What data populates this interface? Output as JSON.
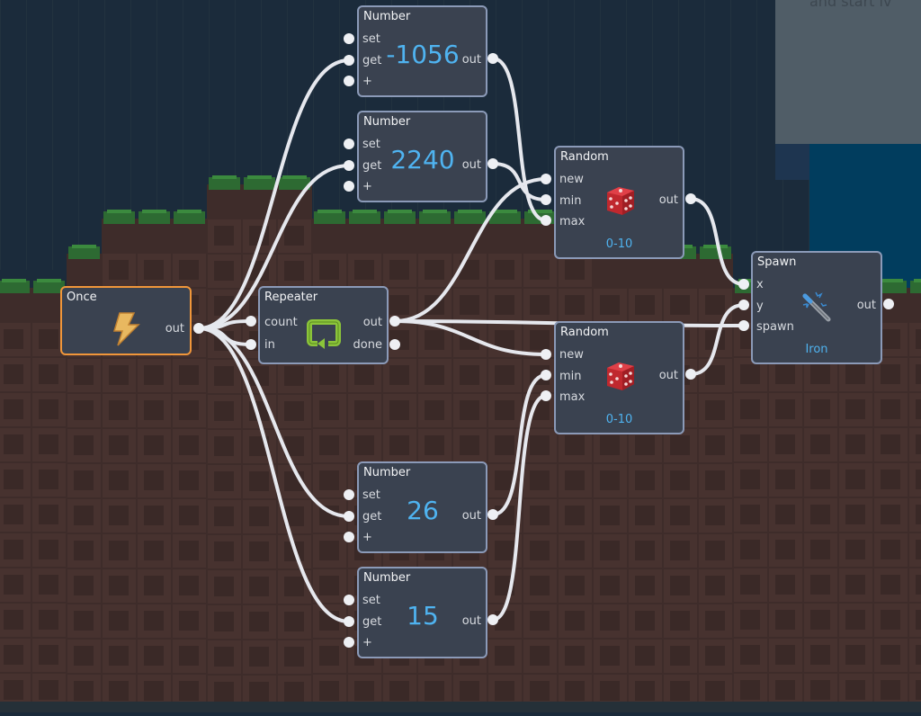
{
  "background": {
    "sky_color": "#1b2b3b",
    "dirt_color": "#3e2c2a",
    "grass_color": "#2d6a32",
    "water_color": "#013d5e",
    "overlay_color": "#505d67",
    "overlay_text": "and start lv"
  },
  "nodes": {
    "once": {
      "title": "Once",
      "icon": "lightning-bolt-icon",
      "outputs": [
        "out"
      ]
    },
    "repeater": {
      "title": "Repeater",
      "icon": "loop-arrow-icon",
      "inputs": [
        "count",
        "in"
      ],
      "outputs": [
        "out",
        "done"
      ]
    },
    "number1": {
      "title": "Number",
      "inputs": [
        "set",
        "get",
        "+"
      ],
      "value": "-1056",
      "outputs": [
        "out"
      ]
    },
    "number2": {
      "title": "Number",
      "inputs": [
        "set",
        "get",
        "+"
      ],
      "value": "2240",
      "outputs": [
        "out"
      ]
    },
    "number3": {
      "title": "Number",
      "inputs": [
        "set",
        "get",
        "+"
      ],
      "value": "26",
      "outputs": [
        "out"
      ]
    },
    "number4": {
      "title": "Number",
      "inputs": [
        "set",
        "get",
        "+"
      ],
      "value": "15",
      "outputs": [
        "out"
      ]
    },
    "random1": {
      "title": "Random",
      "icon": "dice-icon",
      "inputs": [
        "new",
        "min",
        "max"
      ],
      "outputs": [
        "out"
      ],
      "range": "0-10"
    },
    "random2": {
      "title": "Random",
      "icon": "dice-icon",
      "inputs": [
        "new",
        "min",
        "max"
      ],
      "outputs": [
        "out"
      ],
      "range": "0-10"
    },
    "spawn": {
      "title": "Spawn",
      "icon": "sword-icon",
      "inputs": [
        "x",
        "y",
        "spawn"
      ],
      "outputs": [
        "out"
      ],
      "item": "Iron"
    }
  },
  "connections": [
    [
      "once.out",
      "number1.get"
    ],
    [
      "once.out",
      "number2.get"
    ],
    [
      "once.out",
      "repeater.count"
    ],
    [
      "once.out",
      "repeater.in"
    ],
    [
      "once.out",
      "number3.get"
    ],
    [
      "once.out",
      "number4.get"
    ],
    [
      "number1.out",
      "random1.max"
    ],
    [
      "number2.out",
      "random1.min"
    ],
    [
      "number3.out",
      "random2.min"
    ],
    [
      "number4.out",
      "random2.max"
    ],
    [
      "repeater.out",
      "random1.new"
    ],
    [
      "repeater.out",
      "random2.new"
    ],
    [
      "repeater.out",
      "spawn.spawn"
    ],
    [
      "random1.out",
      "spawn.x"
    ],
    [
      "random2.out",
      "spawn.y"
    ]
  ]
}
